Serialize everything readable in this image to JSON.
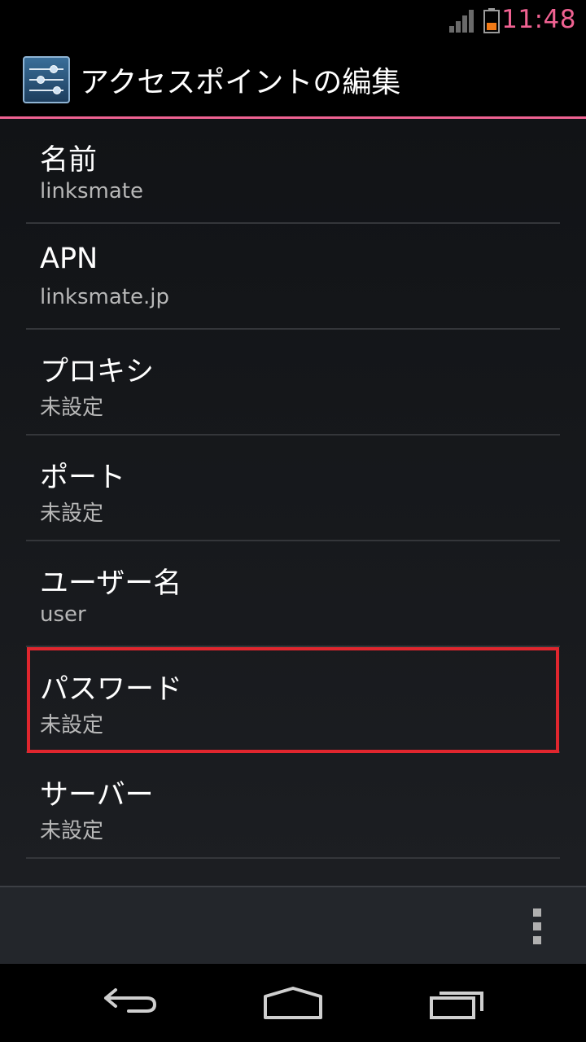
{
  "status_bar": {
    "time": "11:48",
    "signal_icon": "signal-icon",
    "battery_icon": "battery-icon",
    "time_color": "#f06292"
  },
  "action_bar": {
    "title": "アクセスポイントの編集",
    "icon": "settings-sliders-icon",
    "accent": "#f06292"
  },
  "fields": [
    {
      "label": "名前",
      "value": "linksmate"
    },
    {
      "label": "APN",
      "value": "linksmate.jp"
    },
    {
      "label": "プロキシ",
      "value": "未設定"
    },
    {
      "label": "ポート",
      "value": "未設定"
    },
    {
      "label": "ユーザー名",
      "value": "user"
    },
    {
      "label": "パスワード",
      "value": "未設定"
    },
    {
      "label": "サーバー",
      "value": "未設定"
    }
  ],
  "highlight": {
    "field": "パスワード",
    "color": "#e0262e"
  },
  "bottom_bar": {
    "menu_icon": "overflow-menu-icon"
  },
  "nav_bar": {
    "icons": [
      "back-icon",
      "home-icon",
      "recent-apps-icon"
    ]
  }
}
